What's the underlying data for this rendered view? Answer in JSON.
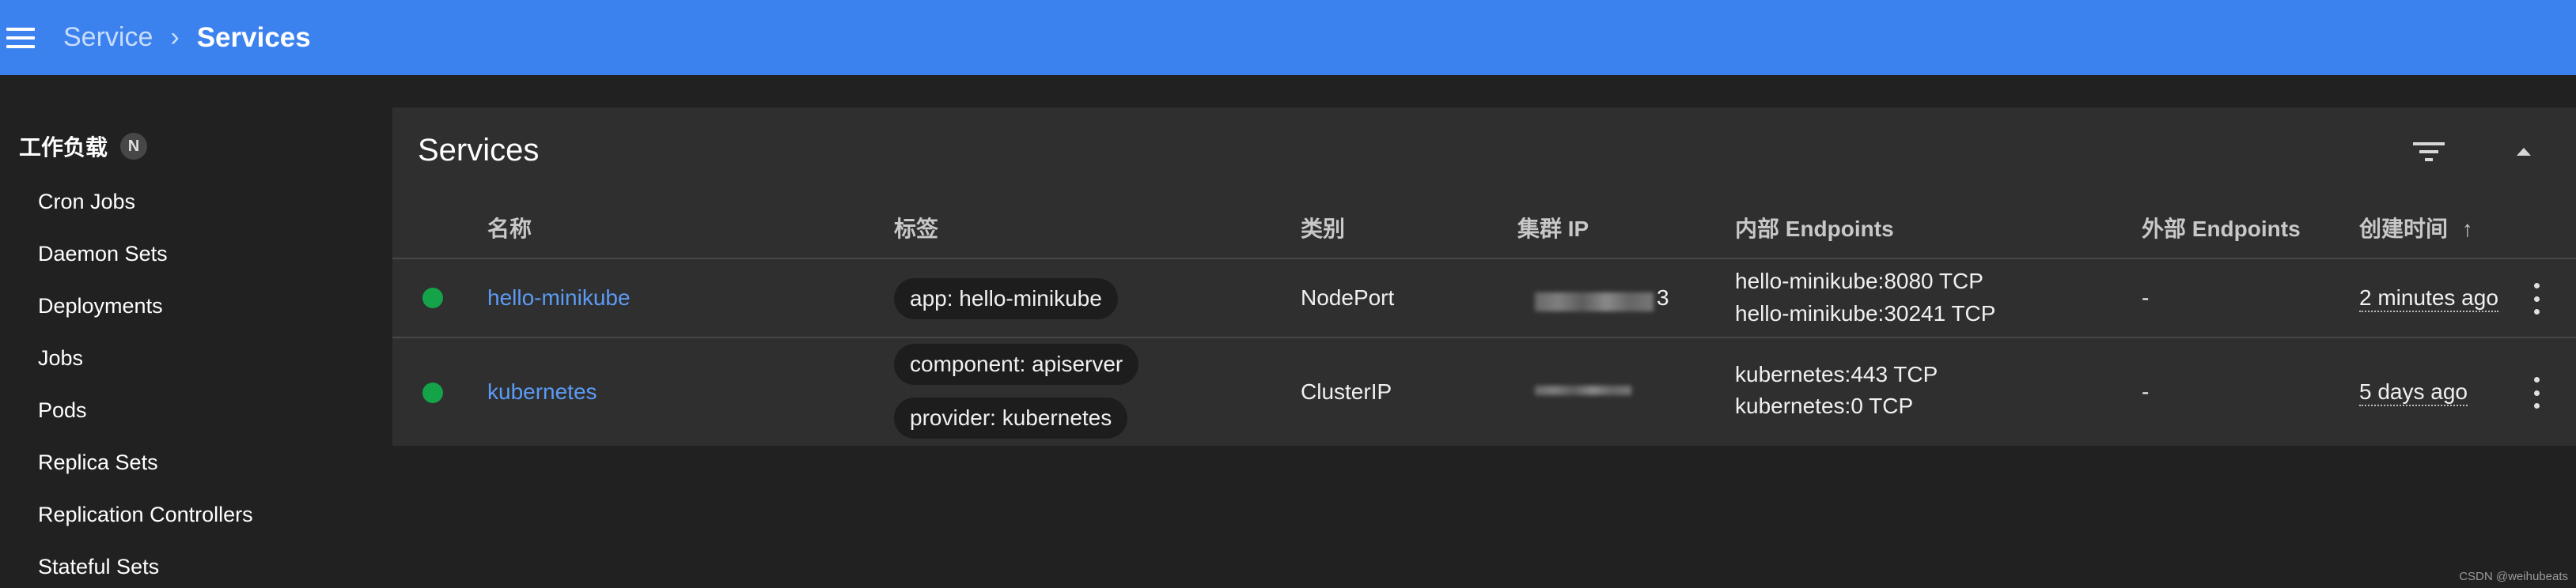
{
  "header": {
    "breadcrumb_parent": "Service",
    "breadcrumb_separator": "›",
    "breadcrumb_current": "Services"
  },
  "sidebar": {
    "section_title": "工作负载",
    "section_badge": "N",
    "items": [
      {
        "label": "Cron Jobs"
      },
      {
        "label": "Daemon Sets"
      },
      {
        "label": "Deployments"
      },
      {
        "label": "Jobs"
      },
      {
        "label": "Pods"
      },
      {
        "label": "Replica Sets"
      },
      {
        "label": "Replication Controllers"
      },
      {
        "label": "Stateful Sets"
      }
    ]
  },
  "card": {
    "title": "Services",
    "columns": {
      "name": "名称",
      "labels": "标签",
      "type": "类别",
      "cluster_ip": "集群 IP",
      "internal_endpoints": "内部 Endpoints",
      "external_endpoints": "外部 Endpoints",
      "created": "创建时间",
      "sort_indicator": "↑"
    },
    "rows": [
      {
        "status": "running",
        "name": "hello-minikube",
        "labels": [
          "app: hello-minikube"
        ],
        "type": "NodePort",
        "cluster_ip_visible_suffix": "3",
        "internal_endpoints": [
          "hello-minikube:8080 TCP",
          "hello-minikube:30241 TCP"
        ],
        "external_endpoints": "-",
        "created": "2 minutes ago"
      },
      {
        "status": "running",
        "name": "kubernetes",
        "labels": [
          "component: apiserver",
          "provider: kubernetes"
        ],
        "type": "ClusterIP",
        "cluster_ip_visible_suffix": "",
        "internal_endpoints": [
          "kubernetes:443 TCP",
          "kubernetes:0 TCP"
        ],
        "external_endpoints": "-",
        "created": "5 days ago"
      }
    ]
  },
  "colors": {
    "topbar": "#3b82ef",
    "link": "#5b9bf5",
    "status_ok": "#15a34a",
    "background": "#212121",
    "card": "#2f2f2f"
  },
  "icons": {
    "menu": "menu-icon",
    "filter": "filter-icon",
    "collapse": "chevron-up-icon",
    "row_menu": "more-vert-icon"
  },
  "watermark": "CSDN @weihubeats"
}
